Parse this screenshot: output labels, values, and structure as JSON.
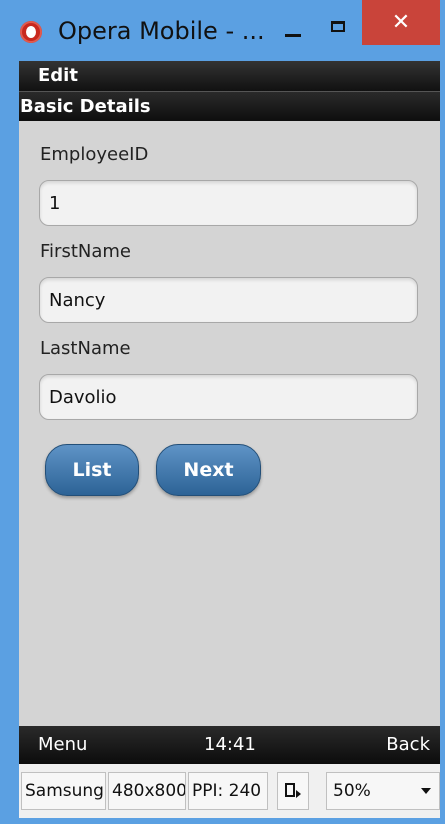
{
  "window": {
    "title": "Opera Mobile - ...",
    "close_symbol": "✕"
  },
  "header": {
    "edit_label": "Edit",
    "section_title": "Basic Details"
  },
  "form": {
    "employee_id_label": "EmployeeID",
    "employee_id_value": "1",
    "first_name_label": "FirstName",
    "first_name_value": "Nancy",
    "last_name_label": "LastName",
    "last_name_value": "Davolio"
  },
  "buttons": {
    "list_label": "List",
    "next_label": "Next"
  },
  "softkeys": {
    "menu_label": "Menu",
    "time": "14:41",
    "back_label": "Back"
  },
  "toolbar": {
    "device": "Samsung",
    "resolution": "480x800",
    "ppi": "PPI: 240",
    "zoom": "50%"
  },
  "colors": {
    "window_frame": "#5ba0e2",
    "close_button": "#c9443a",
    "button_blue": "#3f74a8",
    "screen_bg": "#d4d4d4"
  }
}
